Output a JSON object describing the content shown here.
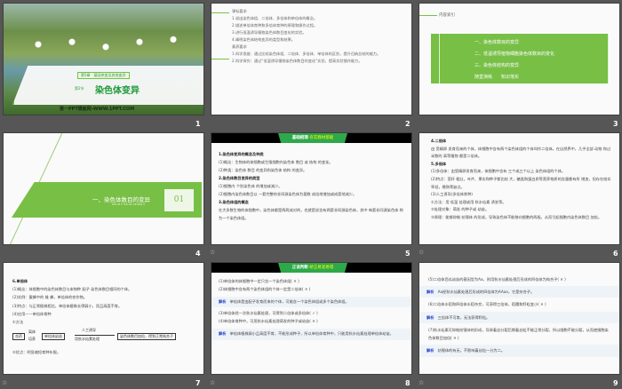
{
  "slides": [
    {
      "number": "1",
      "chapter": "第5章　基因突变及其他变异",
      "section": "第2节",
      "title": "染色体变异",
      "footer": "第一PPT模板网-WWW.1PPT.COM"
    },
    {
      "number": "2",
      "h1": "课标要求",
      "items1": [
        "1.说出染色体组、二倍体、多倍体和单倍体的概念。",
        "2.描述单倍体育种和多倍体育种的原理和操作过程。",
        "3.进行低温诱导植物染色体数目变化的实验。",
        "4.阐明染色体结构变异的类型和结果。"
      ],
      "h2": "素养要求",
      "items2": [
        "1.科学思维：通过比较染色体组、二倍体、多倍体、单倍体的区别，提升归纳总结的能力。",
        "2.科学探究：通过“低温诱导植物染色体数目的变化”实验，提高实验操作能力。"
      ]
    },
    {
      "number": "3",
      "heading": "内容索引",
      "items": [
        "一、染色体数目的变异",
        "二、低温诱导植物细胞染色体数目的变化",
        "三、染色体结构的变异",
        "随堂演练　　知识落实"
      ]
    },
    {
      "number": "4",
      "title": "一、染色体数目的变异",
      "subtitle": "RAN SE TI SHU MU DE BIAN YI",
      "badge": "01"
    },
    {
      "number": "5",
      "tab": "基础梳理",
      "tab2": "夯实教材基础",
      "lines": [
        "1.染色体变异的概念及种类",
        "(1)概念：生物体的体细胞或生殖细胞内染色体 数目 或 结构 的变化。",
        "(2)种类：染色体 数目 的变异和染色体 结构 的变异。",
        "2.染色体数目变异的类型",
        "(1)细胞内 个别染色体 的增加或减少。",
        "(2)细胞内染色体数目以 一套完整的非同源染色体为基数 成倍地增加或成套地减少。",
        "3.染色体组的概念",
        "在大多数生物的体细胞中，染色体都是两两成对的，也就是说含有两套非同源染色体，其中 每套非同源染色体 称为一个染色体组。"
      ]
    },
    {
      "number": "6",
      "lines": [
        "4.二倍体",
        "由 受精卵 发育而来的个体，体细胞中含有两个染色体组的个体叫作二倍体。在自然界中，几乎全部 动物 和过半数的 高等植物 都是二倍体。",
        "5.多倍体",
        "(1)多倍体：由受精卵发育而来，体细胞中含有 三个或三个以上 染色体组的个体。",
        "(2)特点：茎秆 粗壮，叶片、果实和种子都比较 大，糖类和蛋白质等营养物质的含量都有所 增加，但存在结实率低，晚熟等缺点。",
        "(3)人工诱导(多倍体育种)",
        "①方法：用 低温 处理或用 秋水仙素 诱发等。",
        "②处理对象：萌发 的种子或 幼苗。",
        "③原理：能够抑制 纺锤体 的形成，导致染色体不能移向细胞的两极，从而引起细胞内染色体数目 加倍。"
      ]
    },
    {
      "number": "7",
      "lines": [
        "6.单倍体",
        "(1)概念：体细胞中的染色体数目与本物种 配子 染色体数目相同的个体。",
        "(2)实例：蜜蜂中的 雄 蜂，单倍体的农作物。",
        "(3)特点：与正常植株相比，单倍体植株长得弱小，而且高度不育。",
        "(4)应用——单倍体育种",
        "①方法",
        "②优点：明显缩短育种年限。"
      ],
      "flow": {
        "a": "花药",
        "b1": "离体",
        "b2": "培养",
        "c": "单倍体幼苗",
        "d1": "人工诱导",
        "d2": "用秋水仙素处理",
        "e": "染色体数目加倍，得到正常纯合子"
      }
    },
    {
      "number": "8",
      "tab": "正误判断",
      "tab2": "矫正易混易错",
      "q1": "(1)单倍体的体细胞中一定只含一个染色体组(  ✕ )",
      "q2": "(2)体细胞中含有两个染色体组的个体一定是二倍体(  ✕ )",
      "jx_label": "解析",
      "jx1": "单倍体是由配子发育而来的个体，可能含一个染色体组或多个染色体组。",
      "q3": "(3)单倍体经一次秋水仙素处理，可得到二倍体或多倍体(  ✓ )",
      "q4": "(4)单倍体育种中，可用秋水仙素处理萌发的种子或幼苗(  ✕ )",
      "jx2": "单倍体植株弱小且高度不育，不能形成种子，所以单倍体育种中，只能用秋水仙素处理单倍体幼苗。"
    },
    {
      "number": "9",
      "q5": "(5)二倍体西瓜幼苗的基因型为Aa，则用秋水仙素处理后形成的四倍体为纯合子(  ✕ )",
      "jx_label": "解析",
      "jx5": "Aa经秋水仙素处理后形成的四倍体为AAaa，它是杂合子。",
      "q6": "(6)二倍体水稻和四倍体水稻杂交，可获得三倍体，稻穗和籽粒变小(  ✕ )",
      "jx6": "三倍体不可育，无法获得籽粒。",
      "q7": "(7)秋水仙素可抑制纺锤体的形成，导致着丝分裂后期着丝粒不能正常分裂，所以细胞不能分裂，从而使细胞染色体数目加倍(  ✕ )",
      "jx7": "纺锤体的有无，不影响着丝粒一分为二。"
    }
  ],
  "anim_icon": "☆"
}
